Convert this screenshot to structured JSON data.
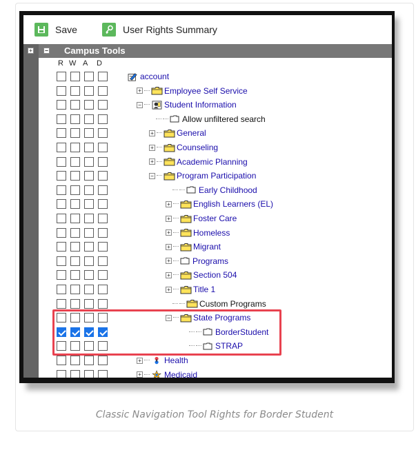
{
  "toolbar": {
    "save_label": "Save",
    "user_rights_label": "User Rights Summary"
  },
  "header": {
    "title": "Campus Tools",
    "columns": [
      "R",
      "W",
      "A",
      "D"
    ]
  },
  "tree": [
    {
      "label": "account",
      "level": 0,
      "icon": "account-icon",
      "expander": "none",
      "rights": [
        false,
        false,
        false,
        false
      ]
    },
    {
      "label": "Employee Self Service",
      "level": 1,
      "icon": "folder-icon",
      "expander": "plus",
      "rights": [
        false,
        false,
        false,
        false
      ]
    },
    {
      "label": "Student Information",
      "level": 1,
      "icon": "student-icon",
      "expander": "minus",
      "rights": [
        false,
        false,
        false,
        false
      ]
    },
    {
      "label": "Allow unfiltered search",
      "level": 2,
      "icon": "document-icon",
      "expander": "none",
      "plain": true,
      "rights": [
        false,
        false,
        false,
        false
      ]
    },
    {
      "label": "General",
      "level": 2,
      "icon": "folder-icon",
      "expander": "plus",
      "rights": [
        false,
        false,
        false,
        false
      ]
    },
    {
      "label": "Counseling",
      "level": 2,
      "icon": "folder-icon",
      "expander": "plus",
      "rights": [
        false,
        false,
        false,
        false
      ]
    },
    {
      "label": "Academic Planning",
      "level": 2,
      "icon": "folder-icon",
      "expander": "plus",
      "rights": [
        false,
        false,
        false,
        false
      ]
    },
    {
      "label": "Program Participation",
      "level": 2,
      "icon": "folder-icon",
      "expander": "minus",
      "rights": [
        false,
        false,
        false,
        false
      ]
    },
    {
      "label": "Early Childhood",
      "level": 3,
      "icon": "document-icon",
      "expander": "none",
      "rights": [
        false,
        false,
        false,
        false
      ]
    },
    {
      "label": "English Learners (EL)",
      "level": 3,
      "icon": "folder-icon",
      "expander": "plus",
      "rights": [
        false,
        false,
        false,
        false
      ]
    },
    {
      "label": "Foster Care",
      "level": 3,
      "icon": "folder-icon",
      "expander": "plus",
      "rights": [
        false,
        false,
        false,
        false
      ]
    },
    {
      "label": "Homeless",
      "level": 3,
      "icon": "folder-icon",
      "expander": "plus",
      "rights": [
        false,
        false,
        false,
        false
      ]
    },
    {
      "label": "Migrant",
      "level": 3,
      "icon": "folder-icon",
      "expander": "plus",
      "rights": [
        false,
        false,
        false,
        false
      ]
    },
    {
      "label": "Programs",
      "level": 3,
      "icon": "document-icon",
      "expander": "plus",
      "rights": [
        false,
        false,
        false,
        false
      ]
    },
    {
      "label": "Section 504",
      "level": 3,
      "icon": "folder-icon",
      "expander": "plus",
      "rights": [
        false,
        false,
        false,
        false
      ]
    },
    {
      "label": "Title 1",
      "level": 3,
      "icon": "folder-icon",
      "expander": "plus",
      "rights": [
        false,
        false,
        false,
        false
      ]
    },
    {
      "label": "Custom Programs",
      "level": 3,
      "icon": "folder-icon",
      "expander": "none",
      "plain": true,
      "rights": [
        false,
        false,
        false,
        false
      ]
    },
    {
      "label": "State Programs",
      "level": 3,
      "icon": "folder-icon",
      "expander": "minus",
      "rights": [
        false,
        false,
        false,
        false
      ]
    },
    {
      "label": "BorderStudent",
      "level": 4,
      "icon": "document-icon",
      "expander": "none",
      "rights": [
        true,
        true,
        true,
        true
      ]
    },
    {
      "label": "STRAP",
      "level": 4,
      "icon": "document-icon",
      "expander": "none",
      "rights": [
        false,
        false,
        false,
        false
      ]
    },
    {
      "label": "Health",
      "level": 1,
      "icon": "health-icon",
      "expander": "plus",
      "rights": [
        false,
        false,
        false,
        false
      ]
    },
    {
      "label": "Medicaid",
      "level": 1,
      "icon": "medicaid-icon",
      "expander": "plus",
      "rights": [
        false,
        false,
        false,
        false
      ]
    }
  ],
  "caption": "Classic Navigation Tool Rights for Border Student",
  "colors": {
    "accent_green": "#5cb85c",
    "link_blue": "#1a0dab",
    "checked_blue": "#1a73e8",
    "highlight_red": "#e8424f",
    "header_gray": "#777777"
  }
}
